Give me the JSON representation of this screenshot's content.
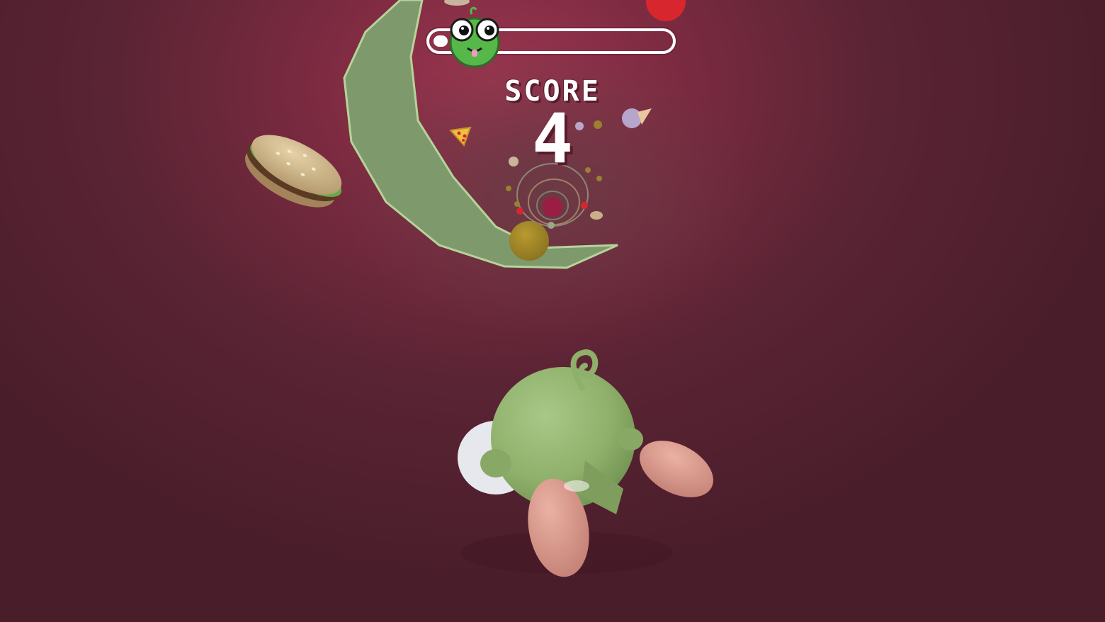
{
  "hud": {
    "score_label": "SCORE",
    "score_value": "4",
    "progress_fraction": 0.06,
    "progress_icon": "frog-face-icon"
  },
  "colors": {
    "background": "#7a2a40",
    "tunnel_center": "#6a3a44",
    "frog_green": "#8fb06a",
    "feet_pink": "#d99b8e",
    "ribbon_green": "#7e9a6c",
    "hud_white": "#ffffff"
  },
  "scene_objects": [
    "burger-icon",
    "pizza-slice-icon",
    "ice-cream-icon",
    "tomato-icon",
    "donut-icon",
    "gold-coin-icon",
    "cookie-icon"
  ]
}
